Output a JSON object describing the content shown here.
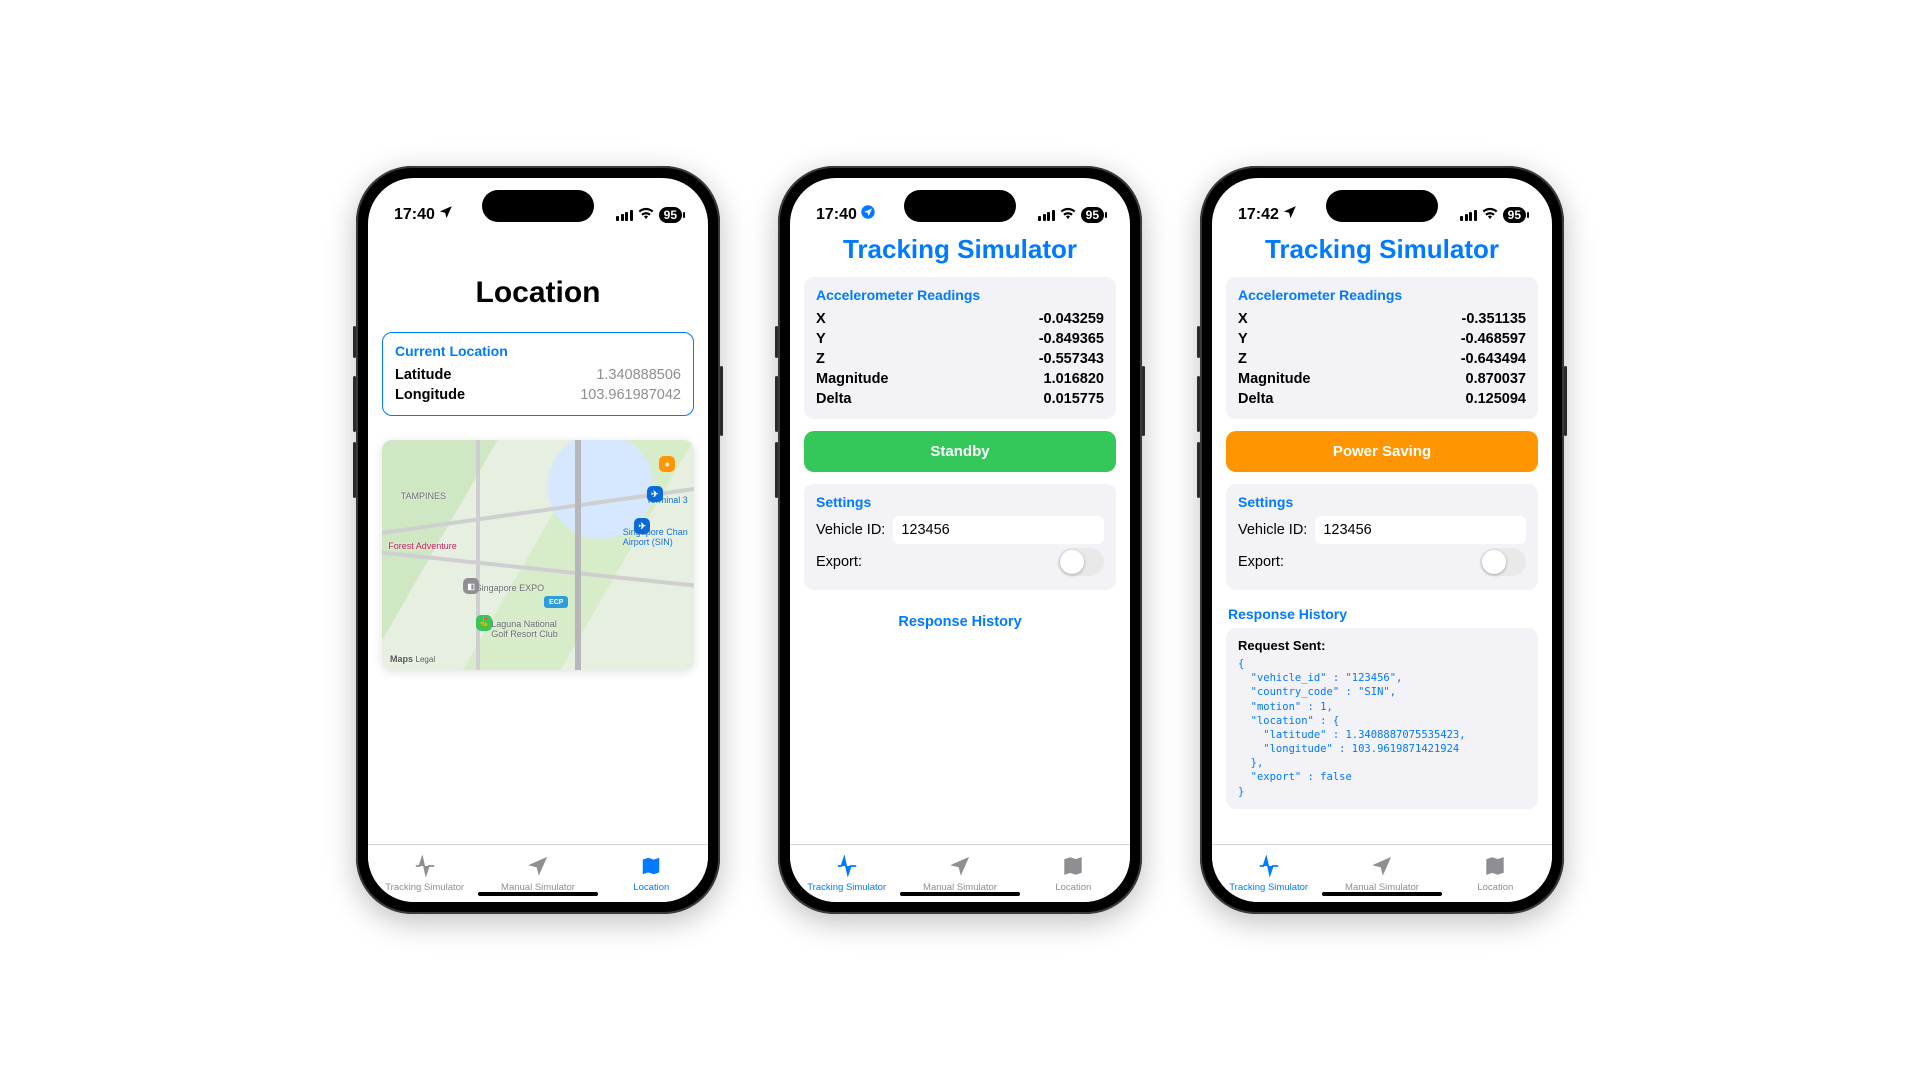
{
  "common": {
    "battery": "95",
    "tabs": {
      "tracking": "Tracking Simulator",
      "manual": "Manual Simulator",
      "location": "Location"
    }
  },
  "phone1": {
    "time": "17:40",
    "title": "Location",
    "card_title": "Current Location",
    "lat_label": "Latitude",
    "lat_value": "1.340888506",
    "lon_label": "Longitude",
    "lon_value": "103.961987042",
    "map": {
      "attr": "Maps",
      "legal": "Legal",
      "labels": {
        "tampines": "TAMPINES",
        "forest": "Forest Adventure",
        "expo": "Singapore EXPO",
        "laguna": "Laguna National\nGolf Resort Club",
        "terminal": "Terminal 3",
        "airport": "Singapore Chan\nAirport (SIN)",
        "ecp": "ECP"
      }
    }
  },
  "phone2": {
    "time": "17:40",
    "title": "Tracking Simulator",
    "accel": {
      "title": "Accelerometer Readings",
      "rows": [
        {
          "k": "X",
          "v": "-0.043259"
        },
        {
          "k": "Y",
          "v": "-0.849365"
        },
        {
          "k": "Z",
          "v": "-0.557343"
        },
        {
          "k": "Magnitude",
          "v": "1.016820"
        },
        {
          "k": "Delta",
          "v": "0.015775"
        }
      ]
    },
    "status_btn": "Standby",
    "settings": {
      "title": "Settings",
      "vehicle_label": "Vehicle ID:",
      "vehicle_value": "123456",
      "export_label": "Export:"
    },
    "response_history": "Response History"
  },
  "phone3": {
    "time": "17:42",
    "title": "Tracking Simulator",
    "accel": {
      "title": "Accelerometer Readings",
      "rows": [
        {
          "k": "X",
          "v": "-0.351135"
        },
        {
          "k": "Y",
          "v": "-0.468597"
        },
        {
          "k": "Z",
          "v": "-0.643494"
        },
        {
          "k": "Magnitude",
          "v": "0.870037"
        },
        {
          "k": "Delta",
          "v": "0.125094"
        }
      ]
    },
    "status_btn": "Power Saving",
    "settings": {
      "title": "Settings",
      "vehicle_label": "Vehicle ID:",
      "vehicle_value": "123456",
      "export_label": "Export:"
    },
    "response_history": "Response History",
    "request": {
      "title": "Request Sent:",
      "body": "{\n  \"vehicle_id\" : \"123456\",\n  \"country_code\" : \"SIN\",\n  \"motion\" : 1,\n  \"location\" : {\n    \"latitude\" : 1.3408887075535423,\n    \"longitude\" : 103.9619871421924\n  },\n  \"export\" : false\n}"
    }
  }
}
